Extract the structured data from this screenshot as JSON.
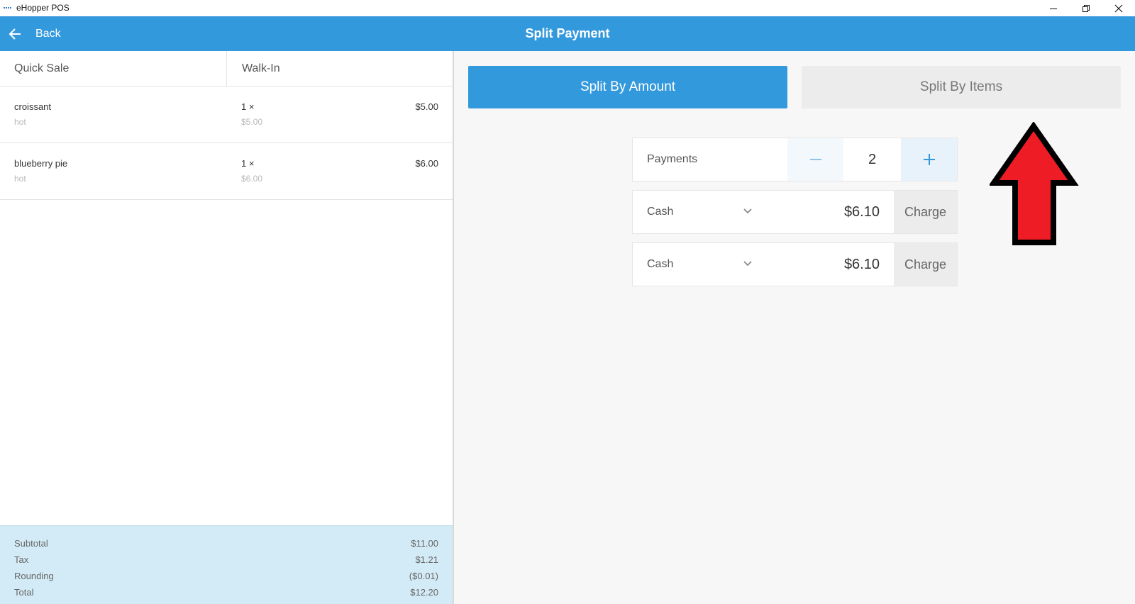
{
  "window": {
    "title": "eHopper POS"
  },
  "header": {
    "back_label": "Back",
    "title": "Split Payment"
  },
  "order": {
    "customer_type": "Quick Sale",
    "customer_name": "Walk-In",
    "items": [
      {
        "name": "croissant",
        "modifier": "hot",
        "quantity": "1 ×",
        "unit_price": "$5.00",
        "price": "$5.00"
      },
      {
        "name": "blueberry pie",
        "modifier": "hot",
        "quantity": "1 ×",
        "unit_price": "$6.00",
        "price": "$6.00"
      }
    ],
    "totals": [
      {
        "label": "Subtotal",
        "value": "$11.00"
      },
      {
        "label": "Tax",
        "value": "$1.21"
      },
      {
        "label": "Rounding",
        "value": "($0.01)"
      },
      {
        "label": "Total",
        "value": "$12.20"
      }
    ]
  },
  "split": {
    "mode_amount_label": "Split By Amount",
    "mode_items_label": "Split By Items",
    "active_mode": "amount",
    "payments_label": "Payments",
    "payments_count": "2",
    "lines": [
      {
        "method": "Cash",
        "amount": "$6.10",
        "charge_label": "Charge"
      },
      {
        "method": "Cash",
        "amount": "$6.10",
        "charge_label": "Charge"
      }
    ]
  },
  "colors": {
    "accent": "#3399dd",
    "totals_bg": "#d3ebf6",
    "annotation_arrow": "#ee1c24"
  },
  "icons": [
    "app-icon",
    "minimize-icon",
    "maximize-icon",
    "close-icon",
    "back-arrow-icon",
    "minus-icon",
    "plus-icon",
    "chevron-down-icon",
    "annotation-up-arrow"
  ]
}
